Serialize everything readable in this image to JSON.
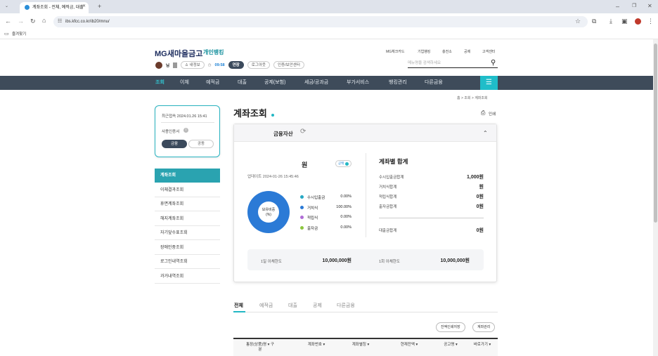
{
  "browser": {
    "tab_title": "계좌조회 - 전체, 예적금, 대출",
    "url": "ibs.kfcc.co.kr/ib20/mnu/",
    "bookmark_folder": "즐겨찾기"
  },
  "header": {
    "brand": "MG새마을금고",
    "brand_sub": "개인뱅킹",
    "util_links": [
      "MG체크카드",
      "기업뱅킹",
      "충전소",
      "공제",
      "고객센터"
    ],
    "search_placeholder": "메뉴명을 검색하세요",
    "user_name": "님",
    "myinfo": "내정보",
    "timer": "09:58",
    "extend": "연장",
    "logout": "로그아웃",
    "cert_center": "인증/보안센터"
  },
  "gnb": {
    "items": [
      "조회",
      "이체",
      "예적금",
      "대출",
      "공제(보험)",
      "세금/공과금",
      "부가서비스",
      "뱅킹관리",
      "다른금융"
    ],
    "active": "조회"
  },
  "breadcrumb": "홈 > 조회 > 계좌조회",
  "login_box": {
    "last_login": "최근접속 2024.01.26 15:41",
    "cert_label": "사용인증서",
    "btn_finance": "금융",
    "btn_common": "공동"
  },
  "side_menu": [
    "계좌조회",
    "이체결과조회",
    "휴면계좌조회",
    "해지계좌조회",
    "자기앞수표조회",
    "장애인중조회",
    "로그인내역조회",
    "과거내역조회"
  ],
  "page": {
    "title": "계좌조회",
    "print": "인쇄"
  },
  "assets": {
    "heading": "금융자산",
    "total_unit": "원",
    "toggle": "공백",
    "updated": "업데이트 2024-01-26 15:45:46",
    "donut_label_1": "보유비중",
    "donut_label_2": "(%)",
    "legend": [
      {
        "label": "수시입출금",
        "pct": "0.00%",
        "color": "#26a8c4"
      },
      {
        "label": "거치식",
        "pct": "100.00%",
        "color": "#2b7ad6"
      },
      {
        "label": "적립식",
        "pct": "0.00%",
        "color": "#b06dd6"
      },
      {
        "label": "출자금",
        "pct": "0.00%",
        "color": "#8cc63f"
      }
    ],
    "summary_title": "계좌별 합계",
    "summary": [
      {
        "label": "수시입출금합계",
        "value": "1,000원"
      },
      {
        "label": "거치식합계",
        "value": "원"
      },
      {
        "label": "적립식합계",
        "value": "0원"
      },
      {
        "label": "출자금합계",
        "value": "0원"
      }
    ],
    "loan_label": "대출금합계",
    "loan_value": "0원",
    "limit_day_label": "1일 이체한도",
    "limit_day_value": "10,000,000원",
    "limit_once_label": "1회 이체한도",
    "limit_once_value": "10,000,000원"
  },
  "bottom_tabs": [
    "전체",
    "예적금",
    "대출",
    "공제",
    "다른금융"
  ],
  "actions": {
    "print_save": "잔액인쇄저장",
    "manage": "계좌관리"
  },
  "table_headers": [
    "통장(상품)명 ▾ 구분",
    "계좌번호 ▾",
    "계좌별칭 ▾",
    "현재잔액 ▾",
    "공고명 ▾",
    "바로가기 ▾"
  ],
  "chart_data": {
    "type": "pie",
    "categories": [
      "수시입출금",
      "거치식",
      "적립식",
      "출자금"
    ],
    "values": [
      0,
      100,
      0,
      0
    ]
  }
}
